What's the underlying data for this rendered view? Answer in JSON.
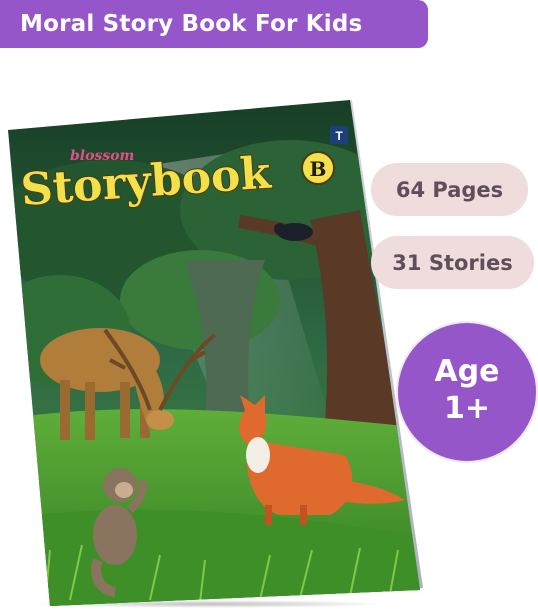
{
  "banner": {
    "title": "Moral Story Book For Kids"
  },
  "book": {
    "brand": "blossom",
    "title": "Storybook",
    "volume": "B",
    "publisher_mark": "T"
  },
  "badges": {
    "pages": "64 Pages",
    "stories": "31 Stories",
    "age_label": "Age",
    "age_value": "1+"
  },
  "colors": {
    "accent_purple": "#9556c9",
    "pill_pink": "#efdcdc",
    "pill_text": "#5f4f5a",
    "title_yellow": "#f3e04a",
    "brand_pink": "#e44f8a"
  }
}
